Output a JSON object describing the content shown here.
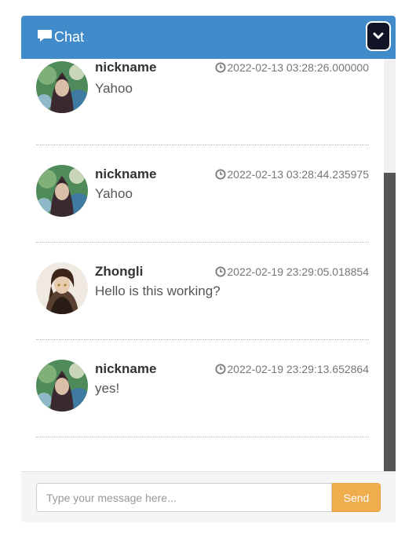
{
  "header": {
    "title": "Chat",
    "icon": "comment-icon",
    "toggle_icon": "chevron-down-icon",
    "color": "#428bca"
  },
  "messages": [
    {
      "name": "nickname",
      "time": "2022-02-13 03:28:26.000000",
      "text": "Yahoo",
      "avatar": "green-haired-avatar"
    },
    {
      "name": "nickname",
      "time": "2022-02-13 03:28:44.235975",
      "text": "Yahoo",
      "avatar": "green-haired-avatar"
    },
    {
      "name": "Zhongli",
      "time": "2022-02-19 23:29:05.018854",
      "text": "Hello is this working?",
      "avatar": "zhongli-avatar"
    },
    {
      "name": "nickname",
      "time": "2022-02-19 23:29:13.652864",
      "text": "yes!",
      "avatar": "green-haired-avatar"
    }
  ],
  "composer": {
    "placeholder": "Type your message here...",
    "send_label": "Send",
    "send_color": "#f0ad4e"
  }
}
